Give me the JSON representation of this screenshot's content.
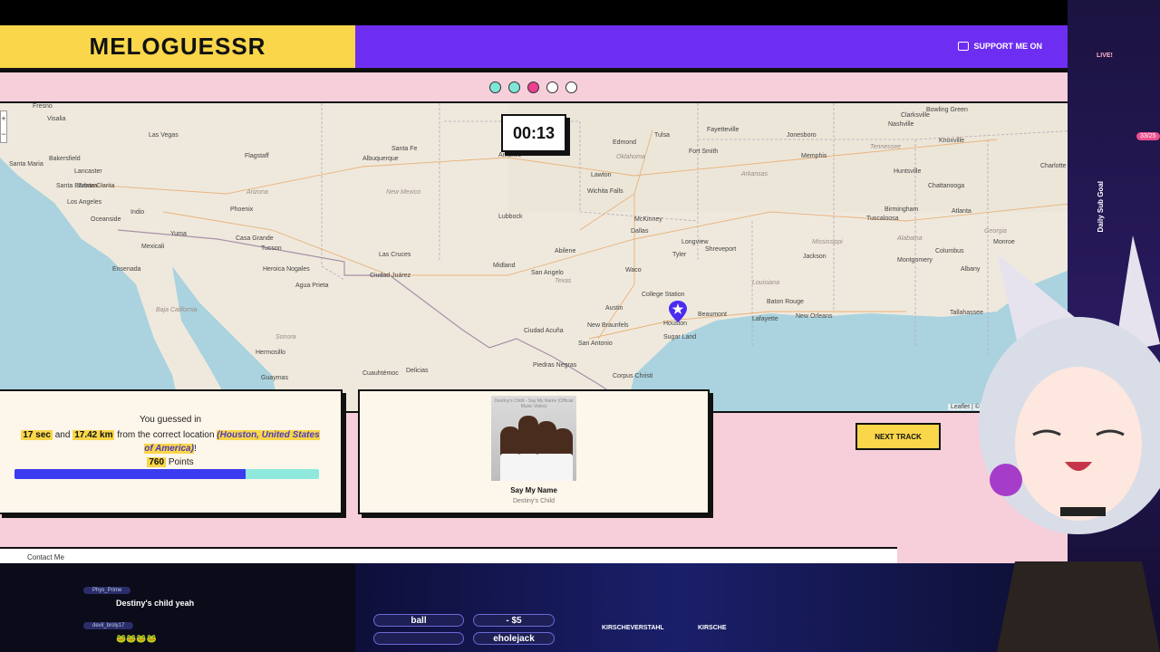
{
  "header": {
    "logo": "MELOGUESSR",
    "support_label": "SUPPORT ME ON"
  },
  "progress_dots": [
    {
      "state": "done"
    },
    {
      "state": "done"
    },
    {
      "state": "active"
    },
    {
      "state": "pending"
    },
    {
      "state": "pending"
    }
  ],
  "map": {
    "timer": "00:13",
    "zoom_in": "+",
    "zoom_out": "−",
    "attribution": "Leaflet | © O",
    "cities": [
      "Fresno",
      "Visalia",
      "Las Vegas",
      "Bakersfield",
      "Santa Maria",
      "Lancaster",
      "Santa Barbara",
      "Los Angeles",
      "Santa Clarita",
      "Oceanside",
      "Indio",
      "Mexicali",
      "Yuma",
      "Phoenix",
      "Casa Grande",
      "Tucson",
      "Heroica Nogales",
      "Agua Prieta",
      "Hermosillo",
      "Guaymas",
      "Ensenada",
      "Flagstaff",
      "Albuquerque",
      "Santa Fe",
      "Las Cruces",
      "Ciudad Juárez",
      "Amarillo",
      "Lubbock",
      "Midland",
      "San Angelo",
      "Abilene",
      "Cuauhtémoc",
      "Delicias",
      "Ciudad Acuña",
      "Piedras Negras",
      "Edmond",
      "Tulsa",
      "Lawton",
      "Wichita Falls",
      "McKinney",
      "Dallas",
      "Waco",
      "Fort Smith",
      "Fayetteville",
      "Austin",
      "College Station",
      "Tyler",
      "Longview",
      "Shreveport",
      "New Braunfels",
      "San Antonio",
      "Houston",
      "Sugar Land",
      "Beaumont",
      "Corpus Christi",
      "Lafayette",
      "Baton Rouge",
      "New Orleans",
      "Jonesboro",
      "Memphis",
      "Nashville",
      "Bowling Green",
      "Clarksville",
      "Knoxville",
      "Huntsville",
      "Chattanooga",
      "Birmingham",
      "Atlanta",
      "Tuscaloosa",
      "Jackson",
      "Montgomery",
      "Columbus",
      "Albany",
      "Tallahassee",
      "Charlotte",
      "Monroe"
    ],
    "states": [
      "Arizona",
      "New Mexico",
      "Texas",
      "Oklahoma",
      "Arkansas",
      "Mississippi",
      "Louisiana",
      "Alabama",
      "Georgia",
      "Tennessee",
      "Sonora",
      "Baja California"
    ]
  },
  "result": {
    "line1": "You guessed in",
    "seconds": "17 sec",
    "and": "and",
    "distance": "17.42 km",
    "from_text": "from the correct location",
    "location": "(Houston, United States of America)",
    "exclaim": "!",
    "points_value": "760",
    "points_label": "Points",
    "score_fraction": 0.76
  },
  "track": {
    "cover_caption": "Destiny's Child - Say My Name (Official Music Video)",
    "song": "Say My Name",
    "artist": "Destiny's Child"
  },
  "next_button": "NEXT TRACK",
  "footer": {
    "contact": "Contact Me"
  },
  "chat": [
    {
      "user": "Phys_Prime",
      "message": "Destiny's child yeah"
    },
    {
      "user": "devil_broly17",
      "message": "🐸🐸🐸🐸"
    }
  ],
  "stream": {
    "latest_follow": "ball",
    "latest_tip": "- $5",
    "latest_sub": "eholejack",
    "twitter": "KIRSCHEVERSTAHL",
    "discord": "KIRSCHE",
    "sub_goal_label": "Daily Sub Goal",
    "sub_goal_count": "33/25",
    "live_label": "LIVE!"
  },
  "colors": {
    "yellow": "#f9d64a",
    "purple": "#6e2ef2",
    "pink": "#f6cfda",
    "accent_blue": "#3b3bf0",
    "teal": "#8fe8dc"
  }
}
